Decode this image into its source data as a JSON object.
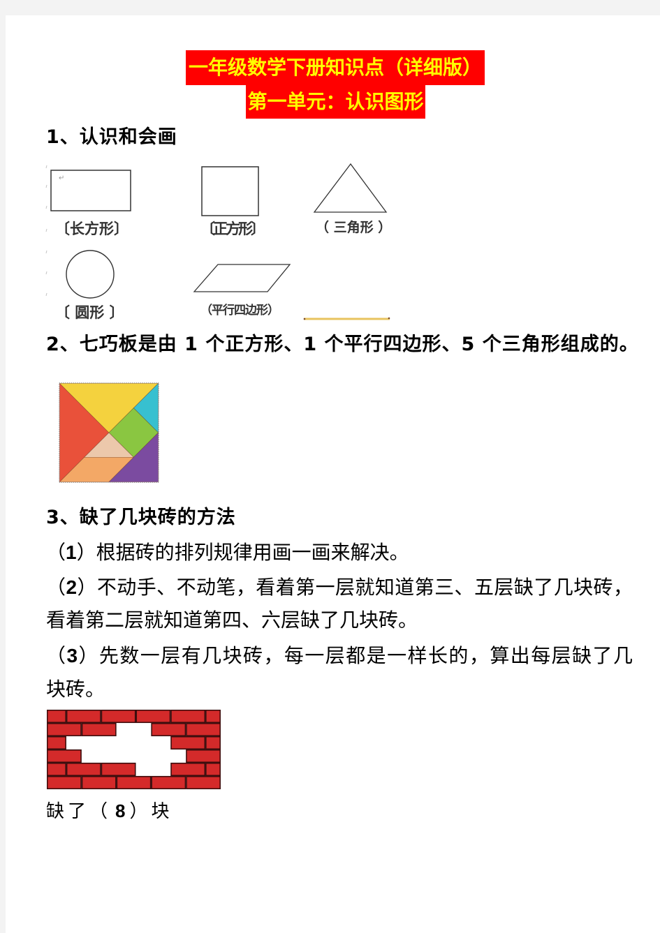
{
  "title": {
    "line1": "一年级数学下册知识点（详细版）",
    "line2": "第一单元：认识图形",
    "background_color": "#ff0000",
    "text_color": "#ffff00"
  },
  "section1": {
    "heading": "1、认识和会画",
    "return_mark": "↵",
    "shapes": [
      {
        "name": "rectangle",
        "label": "〔长方形〕"
      },
      {
        "name": "square",
        "label": "〔正方形〕"
      },
      {
        "name": "triangle",
        "label": "（ 三角形 ）"
      },
      {
        "name": "circle",
        "label": "〔 圆形 〕"
      },
      {
        "name": "parallelogram",
        "label": "（平行四边形）"
      }
    ]
  },
  "section2": {
    "heading": "2、七巧板是由 1 个正方形、1 个平行四边形、5 个三角形组成的。",
    "tangram": {
      "pieces": [
        {
          "name": "large-triangle-left",
          "color": "#e9513a"
        },
        {
          "name": "large-triangle-top",
          "color": "#f4d23e"
        },
        {
          "name": "small-triangle-top-right",
          "color": "#37c0d0"
        },
        {
          "name": "square",
          "color": "#8ac641"
        },
        {
          "name": "small-triangle-center",
          "color": "#ecc8ab"
        },
        {
          "name": "parallelogram",
          "color": "#f3a866"
        },
        {
          "name": "medium-triangle",
          "color": "#7b4ba0"
        }
      ]
    }
  },
  "section3": {
    "heading": "3、缺了几块砖的方法",
    "open": "（",
    "close": "）",
    "items": [
      {
        "number": "1",
        "lines": [
          "根据砖的排列规律用画一画来解决。"
        ]
      },
      {
        "number": "2",
        "lines": [
          "不动手、不动笔，看着第一层就知道第三、五层缺了几块砖，",
          "看着第二层就知道第四、六层缺了几块砖。"
        ]
      },
      {
        "number": "3",
        "lines": [
          "先数一层有几块砖，每一层都是一样长的，算出每层缺了几",
          "块砖。"
        ]
      }
    ],
    "wall": {
      "brick_color": "#d42a2a",
      "mortar_color": "#3d0e0e",
      "rows": [
        {
          "stagger": true,
          "missing": []
        },
        {
          "stagger": false,
          "missing": [
            2
          ]
        },
        {
          "stagger": true,
          "missing": [
            1,
            2,
            3
          ]
        },
        {
          "stagger": false,
          "missing": [
            1,
            2,
            3
          ]
        },
        {
          "stagger": true,
          "missing": [
            3
          ]
        },
        {
          "stagger": false,
          "missing": []
        }
      ]
    },
    "answer": {
      "prefix": "缺了（",
      "value": "8",
      "suffix": "）块"
    }
  }
}
